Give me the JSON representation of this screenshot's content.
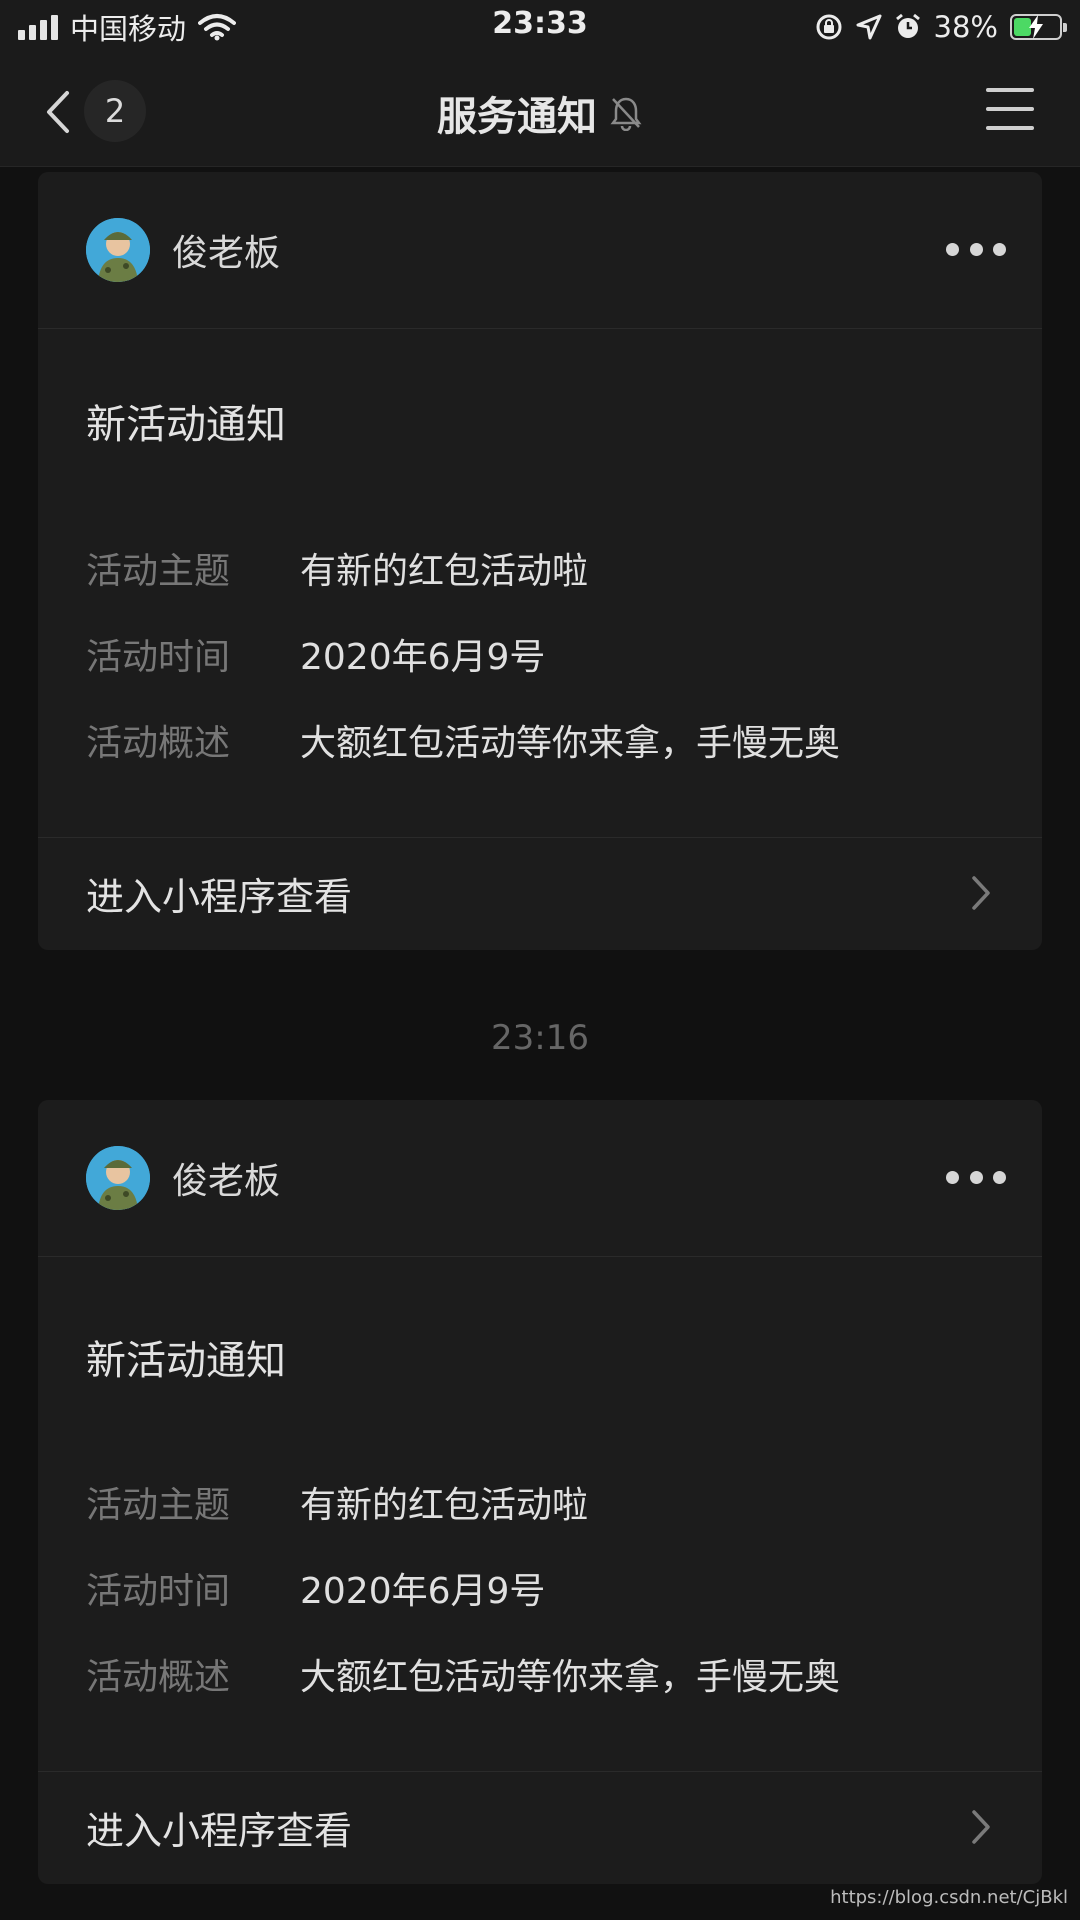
{
  "status_bar": {
    "carrier": "中国移动",
    "time": "23:33",
    "battery_percent": "38%",
    "battery_level": 0.38,
    "icons": [
      "signal-icon",
      "wifi-icon",
      "rotation-lock-icon",
      "location-icon",
      "alarm-icon",
      "battery-icon"
    ]
  },
  "nav": {
    "back_icon": "chevron-left-icon",
    "unread_count": "2",
    "title": "服务通知",
    "mute_icon": "bell-muted-icon",
    "menu_icon": "hamburger-menu-icon"
  },
  "messages": [
    {
      "sender": "俊老板",
      "title": "新活动通知",
      "fields": [
        {
          "label": "活动主题",
          "value": "有新的红包活动啦"
        },
        {
          "label": "活动时间",
          "value": "2020年6月9号"
        },
        {
          "label": "活动概述",
          "value": "大额红包活动等你来拿，手慢无奥"
        }
      ],
      "footer": "进入小程序查看"
    },
    {
      "sender": "俊老板",
      "title": "新活动通知",
      "fields": [
        {
          "label": "活动主题",
          "value": "有新的红包活动啦"
        },
        {
          "label": "活动时间",
          "value": "2020年6月9号"
        },
        {
          "label": "活动概述",
          "value": "大额红包活动等你来拿，手慢无奥"
        }
      ],
      "footer": "进入小程序查看"
    }
  ],
  "time_divider": "23:16",
  "watermark": "https://blog.csdn.net/CjBkl",
  "colors": {
    "background": "#111111",
    "card": "#1c1c1c",
    "label": "#777777",
    "text": "#e0e0e0",
    "battery_green": "#4cd964"
  }
}
